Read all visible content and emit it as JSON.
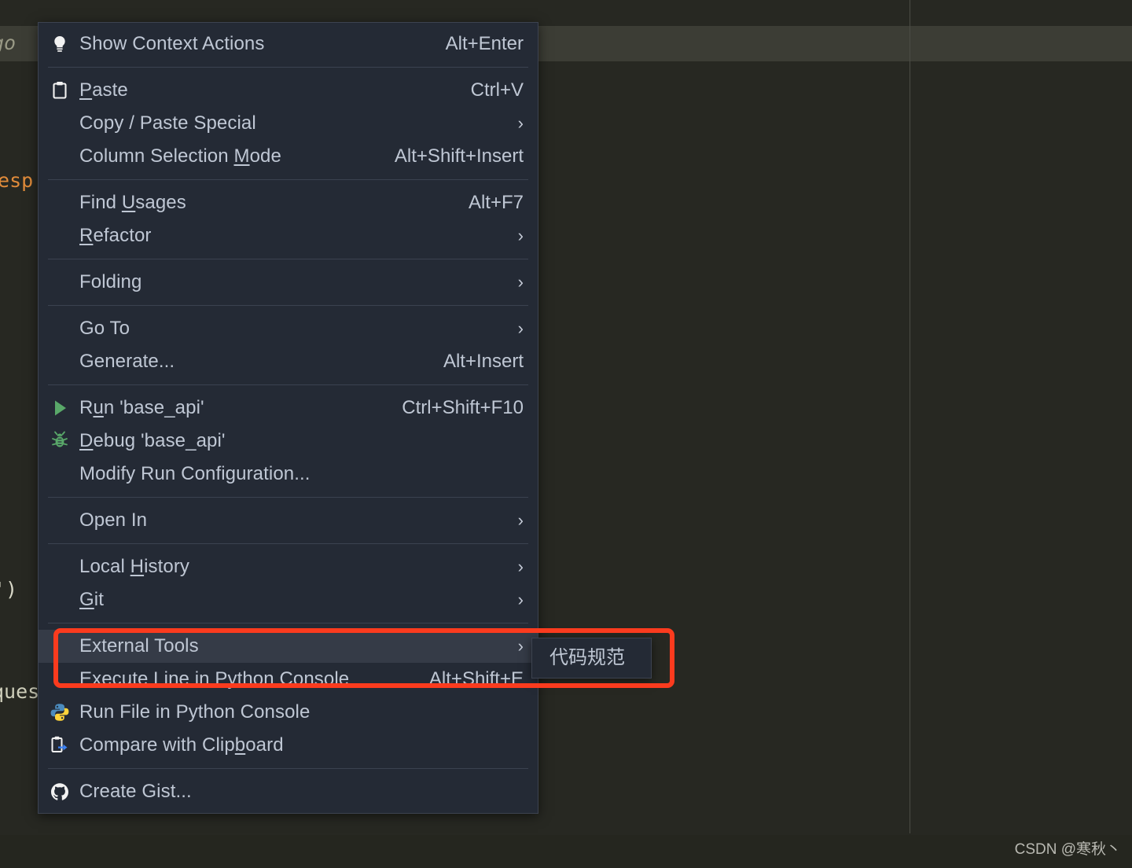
{
  "editor": {
    "code_fragments": [
      {
        "id": "go",
        "text": "go"
      },
      {
        "id": "resp",
        "text": "resp"
      },
      {
        "id": "paren",
        "text": "')"
      },
      {
        "id": "ques",
        "text": "ques"
      }
    ]
  },
  "context_menu": {
    "items": [
      {
        "icon": "lightbulb-icon",
        "label": "Show Context Actions",
        "shortcut": "Alt+Enter",
        "arrow": false
      },
      {
        "separator": true
      },
      {
        "icon": "clipboard-icon",
        "label": "Paste",
        "mnemonic": "P",
        "shortcut": "Ctrl+V",
        "arrow": false
      },
      {
        "icon": "",
        "label": "Copy / Paste Special",
        "shortcut": "",
        "arrow": true
      },
      {
        "icon": "",
        "label": "Column Selection Mode",
        "mnemonic": "M",
        "shortcut": "Alt+Shift+Insert",
        "arrow": false
      },
      {
        "separator": true
      },
      {
        "icon": "",
        "label": "Find Usages",
        "mnemonic": "U",
        "shortcut": "Alt+F7",
        "arrow": false
      },
      {
        "icon": "",
        "label": "Refactor",
        "mnemonic": "R",
        "shortcut": "",
        "arrow": true
      },
      {
        "separator": true
      },
      {
        "icon": "",
        "label": "Folding",
        "shortcut": "",
        "arrow": true
      },
      {
        "separator": true
      },
      {
        "icon": "",
        "label": "Go To",
        "shortcut": "",
        "arrow": true
      },
      {
        "icon": "",
        "label": "Generate...",
        "shortcut": "Alt+Insert",
        "arrow": false
      },
      {
        "separator": true
      },
      {
        "icon": "run-icon",
        "label": "Run 'base_api'",
        "mnemonic": "u",
        "shortcut": "Ctrl+Shift+F10",
        "arrow": false
      },
      {
        "icon": "debug-icon",
        "label": "Debug 'base_api'",
        "mnemonic": "D",
        "shortcut": "",
        "arrow": false
      },
      {
        "icon": "",
        "label": "Modify Run Configuration...",
        "shortcut": "",
        "arrow": false
      },
      {
        "separator": true
      },
      {
        "icon": "",
        "label": "Open In",
        "shortcut": "",
        "arrow": true
      },
      {
        "separator": true
      },
      {
        "icon": "",
        "label": "Local History",
        "mnemonic": "H",
        "shortcut": "",
        "arrow": true
      },
      {
        "icon": "",
        "label": "Git",
        "mnemonic": "G",
        "shortcut": "",
        "arrow": true
      },
      {
        "separator": true
      },
      {
        "icon": "",
        "label": "External Tools",
        "shortcut": "",
        "arrow": true,
        "selected": true
      },
      {
        "icon": "",
        "label": "Execute Line in Python Console",
        "shortcut": "Alt+Shift+E",
        "arrow": false
      },
      {
        "icon": "python-icon",
        "label": "Run File in Python Console",
        "shortcut": "",
        "arrow": false
      },
      {
        "icon": "compare-clipboard-icon",
        "label": "Compare with Clipboard",
        "mnemonic": "b",
        "shortcut": "",
        "arrow": false
      },
      {
        "separator": true
      },
      {
        "icon": "github-icon",
        "label": "Create Gist...",
        "shortcut": "",
        "arrow": false
      }
    ]
  },
  "submenu": {
    "items": [
      {
        "label": "代码规范"
      }
    ]
  },
  "annotation": {
    "color": "#fb3b1e"
  },
  "watermark": {
    "text": "CSDN @寒秋丶"
  }
}
